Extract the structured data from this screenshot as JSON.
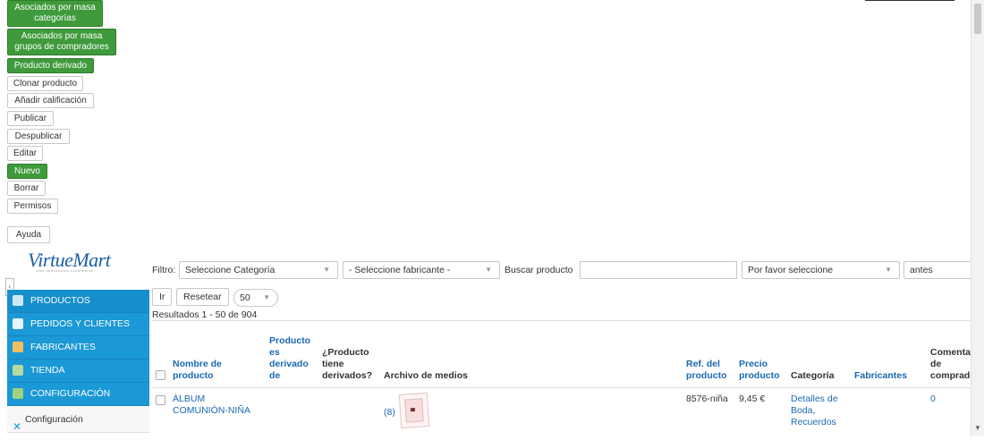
{
  "toolbar": {
    "buttons": [
      {
        "label": "Asociados por masa categorías",
        "style": "green"
      },
      {
        "label": "Asociados por masa grupos de compradores",
        "style": "green"
      },
      {
        "label": "Producto derivado",
        "style": "green"
      },
      {
        "label": "Clonar producto",
        "style": "default"
      },
      {
        "label": "Añadir calificación",
        "style": "default"
      },
      {
        "label": "Publicar",
        "style": "default"
      },
      {
        "label": "Despublicar",
        "style": "default"
      },
      {
        "label": "Editar",
        "style": "default"
      },
      {
        "label": "Nuevo",
        "style": "green"
      },
      {
        "label": "Borrar",
        "style": "default"
      },
      {
        "label": "Permisos",
        "style": "default"
      },
      {
        "label": "Ayuda",
        "style": "default"
      }
    ]
  },
  "sidebar": {
    "logo_text": "VirtueMart",
    "logo_tagline": "free opensource ecommerce",
    "collapse_icon": "chevron-left-icon",
    "menu": [
      {
        "label": "PRODUCTOS",
        "icon": "products-icon"
      },
      {
        "label": "PEDIDOS Y CLIENTES",
        "icon": "orders-icon"
      },
      {
        "label": "FABRICANTES",
        "icon": "wrench-icon"
      },
      {
        "label": "TIENDA",
        "icon": "store-icon"
      },
      {
        "label": "CONFIGURACIÓN",
        "icon": "config-icon"
      }
    ],
    "submenu_item": "Configuración"
  },
  "filters": {
    "filter_label": "Filtro:",
    "category_select": "Seleccione Categoría",
    "manufacturer_select": "- Seleccione fabricante -",
    "search_label": "Buscar producto",
    "search_value": "",
    "please_select": "Por favor seleccione",
    "date_select": "antes",
    "go_button": "Ir",
    "reset_button": "Resetear",
    "per_page": "50"
  },
  "results_text": "Resultados 1 - 50 de 904",
  "table": {
    "headers": {
      "name": "Nombre de producto",
      "is_child": "Producto es derivado de",
      "has_children": "¿Producto tiene derivados?",
      "media": "Archivo de medios",
      "sku": "Ref. del producto",
      "price": "Precio producto",
      "category": "Categoría",
      "manufacturers": "Fabricantes",
      "reviews": "Comentarios de compradores"
    },
    "rows": [
      {
        "name": "ÀLBUM COMUNIÓN-NIÑA",
        "is_child": "",
        "has_children": "",
        "media_count": "(8)",
        "sku": "8576-niña",
        "price": "9,45 €",
        "category": "Detalles de Boda, Recuerdos",
        "manufacturers": "",
        "reviews": "0"
      }
    ]
  },
  "colors": {
    "green_button": "#3f9a3c",
    "menu_blue": "#1b98d6",
    "link_blue": "#1a68b3"
  }
}
